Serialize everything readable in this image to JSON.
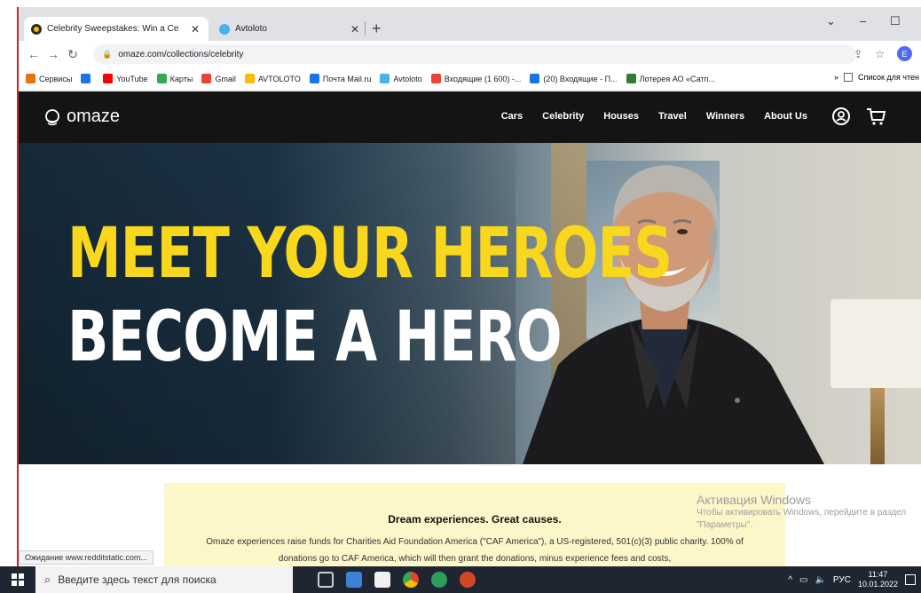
{
  "browser": {
    "tabs": [
      {
        "label": "Celebrity Sweepstakes: Win a Ce",
        "close": "✕",
        "active": true
      },
      {
        "label": "Avtoloto",
        "close": "✕",
        "active": false
      }
    ],
    "new_tab": "+",
    "window_controls": {
      "dropdown": "⌄",
      "minimize": "–",
      "maximize": "☐"
    },
    "url": "omaze.com/collections/celebrity",
    "profile_initial": "E",
    "bookmarks": [
      {
        "label": "Сервисы",
        "icon": "apps-grid-icon",
        "color": "#e8710a"
      },
      {
        "label": "",
        "icon": "opera-icon",
        "color": "#1a73e8"
      },
      {
        "label": "YouTube",
        "icon": "youtube-icon",
        "color": "#ff0000"
      },
      {
        "label": "Карты",
        "icon": "maps-icon",
        "color": "#34a853"
      },
      {
        "label": "Gmail",
        "icon": "gmail-icon",
        "color": "#ea4335"
      },
      {
        "label": "AVTOLOTO",
        "icon": "twentyfour-icon",
        "color": "#fbbc04"
      },
      {
        "label": "Почта Mail.ru",
        "icon": "mail-ru-icon",
        "color": "#1a73e8"
      },
      {
        "label": "Avtoloto",
        "icon": "avtoloto-icon",
        "color": "#4ab0f0"
      },
      {
        "label": "Входящие (1 600) -...",
        "icon": "gmail-icon",
        "color": "#ea4335"
      },
      {
        "label": "(20) Входящие - П...",
        "icon": "mail-ru-icon",
        "color": "#1a73e8"
      },
      {
        "label": "Лотерея АО «Сатп...",
        "icon": "lottery-icon",
        "color": "#2e7d32"
      }
    ],
    "bookmarks_more": "»",
    "reading_list": "Список для чтен"
  },
  "site": {
    "logo": "omaze",
    "nav": [
      "Cars",
      "Celebrity",
      "Houses",
      "Travel",
      "Winners",
      "About Us"
    ],
    "hero": {
      "line1": "MEET YOUR HEROES",
      "line2": "BECOME A HERO"
    },
    "card": {
      "title": "Dream experiences. Great causes.",
      "text": "Omaze experiences raise funds for Charities Aid Foundation America (\"CAF America\"), a US-registered, 501(c)(3) public charity. 100% of donations go to CAF America, which will then grant the donations, minus experience fees and costs,"
    }
  },
  "watermark": {
    "title": "Активация Windows",
    "subtitle": "Чтобы активировать Windows, перейдите в раздел \"Параметры\"."
  },
  "status_text": "Ожидание www.redditstatic.com...",
  "taskbar": {
    "search_placeholder": "Введите здесь текст для поиска",
    "lang": "РУС",
    "time": "11:47",
    "date": "10.01.2022"
  },
  "colors": {
    "accent_yellow": "#f9d71c",
    "nav_bg": "#141414",
    "card_bg": "#fdf6c9"
  }
}
